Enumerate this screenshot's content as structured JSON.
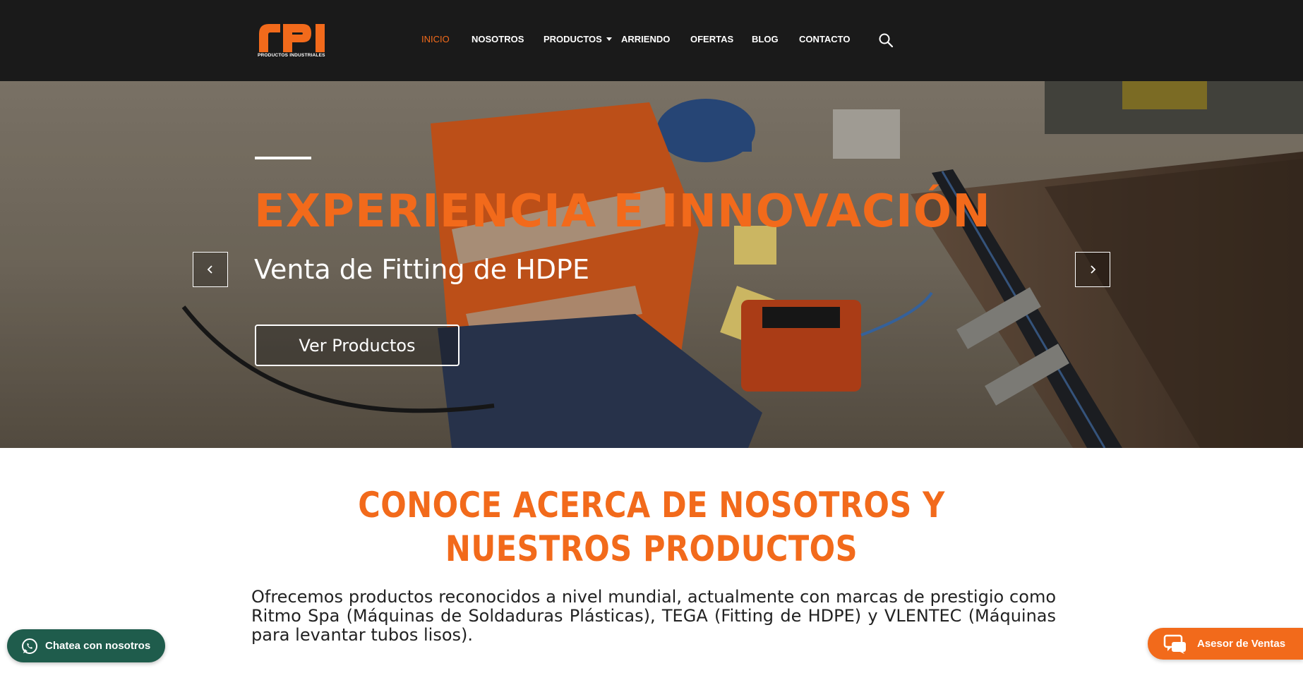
{
  "brand": {
    "logo_text": "rPI",
    "logo_subtitle": "PRODUCTOS INDUSTRIALES",
    "accent": "#f26a1b",
    "header_bg": "#1a1a1a"
  },
  "nav": {
    "items": [
      {
        "label": "INICIO",
        "active": true
      },
      {
        "label": "NOSOTROS"
      },
      {
        "label": "PRODUCTOS",
        "has_dropdown": true
      },
      {
        "label": "ARRIENDO"
      },
      {
        "label": "OFERTAS"
      },
      {
        "label": "BLOG"
      },
      {
        "label": "CONTACTO"
      }
    ],
    "search_icon": "search-icon"
  },
  "hero": {
    "title": "EXPERIENCIA E INNOVACIÓN",
    "subtitle": "Venta de Fitting de HDPE",
    "button_label": "Ver Productos",
    "prev_icon": "chevron-left-icon",
    "next_icon": "chevron-right-icon"
  },
  "about": {
    "title_line1": "CONOCE ACERCA DE NOSOTROS Y",
    "title_line2": "NUESTROS PRODUCTOS",
    "text": "Ofrecemos productos reconocidos a nivel mundial, actualmente con marcas de prestigio como Ritmo Spa (Máquinas de Soldaduras Plásticas), TEGA (Fitting de HDPE) y VLENTEC (Máquinas para levantar tubos lisos)."
  },
  "floating": {
    "whatsapp_label": "Chatea con nosotros",
    "whatsapp_color": "#1f5c4c",
    "advisor_label": "Asesor de Ventas"
  }
}
